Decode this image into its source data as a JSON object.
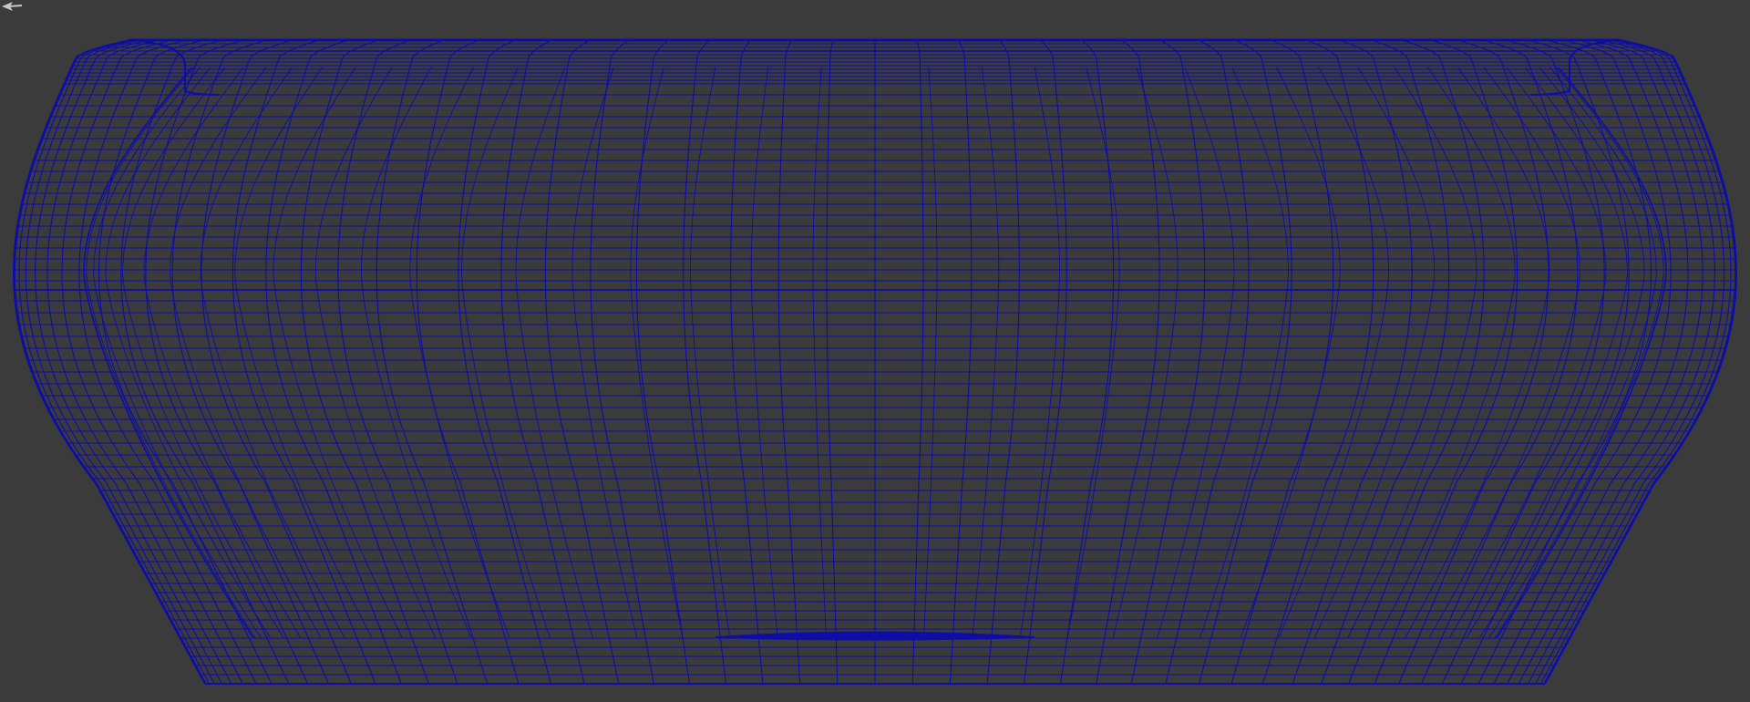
{
  "viewport": {
    "background_color": "#3b3b3b",
    "display_mode": "wireframe",
    "view": "front-orthographic"
  },
  "mesh": {
    "object_type": "vase-body",
    "wire_color": "#0d0da8",
    "silhouette": "lathe-revolved-vessel",
    "cap_rim_visible": true,
    "base_plate_visible": true
  },
  "gizmo": {
    "icon": "view-axis-icon",
    "color": "#c8c8c8"
  }
}
